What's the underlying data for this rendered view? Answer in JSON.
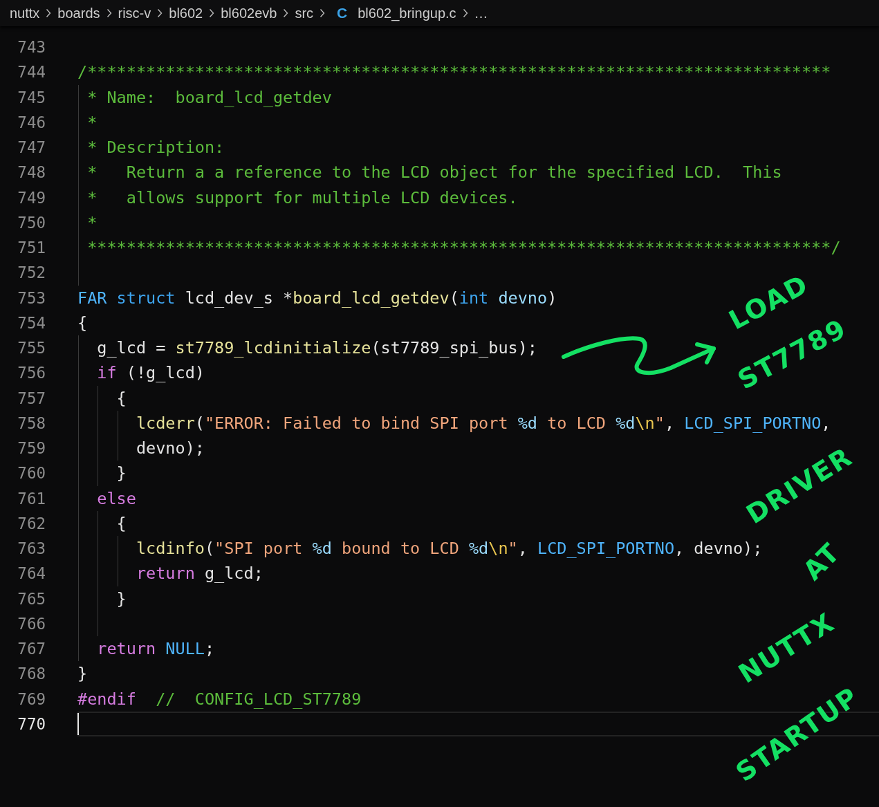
{
  "breadcrumb": {
    "items": [
      {
        "label": "nuttx",
        "kind": "folder"
      },
      {
        "label": "boards",
        "kind": "folder"
      },
      {
        "label": "risc-v",
        "kind": "folder"
      },
      {
        "label": "bl602",
        "kind": "folder"
      },
      {
        "label": "bl602evb",
        "kind": "folder"
      },
      {
        "label": "src",
        "kind": "folder"
      },
      {
        "label": "bl602_bringup.c",
        "kind": "file",
        "file_icon": "C"
      },
      {
        "label": "…",
        "kind": "more"
      }
    ]
  },
  "editor": {
    "lines": [
      {
        "number": "743",
        "current": false
      },
      {
        "number": "744",
        "current": false,
        "tokens": [
          {
            "text": "/****************************************************************************",
            "kind": "comment"
          }
        ]
      },
      {
        "number": "745",
        "current": false,
        "tokens": [
          {
            "text": " * Name:  board_lcd_getdev",
            "kind": "comment"
          }
        ]
      },
      {
        "number": "746",
        "current": false,
        "tokens": [
          {
            "text": " *",
            "kind": "comment"
          }
        ]
      },
      {
        "number": "747",
        "current": false,
        "tokens": [
          {
            "text": " * Description:",
            "kind": "comment"
          }
        ]
      },
      {
        "number": "748",
        "current": false,
        "tokens": [
          {
            "text": " *   Return a a reference to the LCD object for the specified LCD.  This",
            "kind": "comment"
          }
        ]
      },
      {
        "number": "749",
        "current": false,
        "tokens": [
          {
            "text": " *   allows support for multiple LCD devices.",
            "kind": "comment"
          }
        ]
      },
      {
        "number": "750",
        "current": false,
        "tokens": [
          {
            "text": " *",
            "kind": "comment"
          }
        ]
      },
      {
        "number": "751",
        "current": false,
        "tokens": [
          {
            "text": " ****************************************************************************/",
            "kind": "comment"
          }
        ]
      },
      {
        "number": "752",
        "current": false
      },
      {
        "number": "753",
        "current": false,
        "tokens": [
          {
            "text": "FAR ",
            "kind": "macro"
          },
          {
            "text": "struct",
            "kind": "keyword"
          },
          {
            "text": " lcd_dev_s *",
            "kind": "plain"
          },
          {
            "text": "board_lcd_getdev",
            "kind": "function"
          },
          {
            "text": "(",
            "kind": "plain"
          },
          {
            "text": "int ",
            "kind": "keyword"
          },
          {
            "text": "devno",
            "kind": "param"
          },
          {
            "text": ")",
            "kind": "plain"
          }
        ]
      },
      {
        "number": "754",
        "current": false,
        "tokens": [
          {
            "text": "{",
            "kind": "plain"
          }
        ]
      },
      {
        "number": "755",
        "current": false,
        "tokens": [
          {
            "text": "  g_lcd = ",
            "kind": "plain"
          },
          {
            "text": "st7789_lcdinitialize",
            "kind": "function"
          },
          {
            "text": "(st7789_spi_bus);",
            "kind": "plain"
          }
        ]
      },
      {
        "number": "756",
        "current": false,
        "tokens": [
          {
            "text": "  if",
            "kind": "control"
          },
          {
            "text": " (!g_lcd)",
            "kind": "plain"
          }
        ]
      },
      {
        "number": "757",
        "current": false,
        "tokens": [
          {
            "text": "    {",
            "kind": "plain"
          }
        ]
      },
      {
        "number": "758",
        "current": false,
        "tokens": [
          {
            "text": "      lcderr",
            "kind": "function"
          },
          {
            "text": "(",
            "kind": "plain"
          },
          {
            "text": "\"ERROR: Failed to bind SPI port ",
            "kind": "string"
          },
          {
            "text": "%d",
            "kind": "format"
          },
          {
            "text": " to LCD ",
            "kind": "string"
          },
          {
            "text": "%d",
            "kind": "format"
          },
          {
            "text": "\\n",
            "kind": "escape"
          },
          {
            "text": "\"",
            "kind": "string"
          },
          {
            "text": ", ",
            "kind": "plain"
          },
          {
            "text": "LCD_SPI_PORTNO",
            "kind": "macro"
          },
          {
            "text": ",",
            "kind": "plain"
          }
        ]
      },
      {
        "number": "759",
        "current": false,
        "tokens": [
          {
            "text": "      devno);",
            "kind": "plain"
          }
        ]
      },
      {
        "number": "760",
        "current": false,
        "tokens": [
          {
            "text": "    }",
            "kind": "plain"
          }
        ]
      },
      {
        "number": "761",
        "current": false,
        "tokens": [
          {
            "text": "  else",
            "kind": "control"
          }
        ]
      },
      {
        "number": "762",
        "current": false,
        "tokens": [
          {
            "text": "    {",
            "kind": "plain"
          }
        ]
      },
      {
        "number": "763",
        "current": false,
        "tokens": [
          {
            "text": "      lcdinfo",
            "kind": "function"
          },
          {
            "text": "(",
            "kind": "plain"
          },
          {
            "text": "\"SPI port ",
            "kind": "string"
          },
          {
            "text": "%d",
            "kind": "format"
          },
          {
            "text": " bound to LCD ",
            "kind": "string"
          },
          {
            "text": "%d",
            "kind": "format"
          },
          {
            "text": "\\n",
            "kind": "escape"
          },
          {
            "text": "\"",
            "kind": "string"
          },
          {
            "text": ", ",
            "kind": "plain"
          },
          {
            "text": "LCD_SPI_PORTNO",
            "kind": "macro"
          },
          {
            "text": ", devno);",
            "kind": "plain"
          }
        ]
      },
      {
        "number": "764",
        "current": false,
        "tokens": [
          {
            "text": "      return",
            "kind": "control"
          },
          {
            "text": " g_lcd;",
            "kind": "plain"
          }
        ]
      },
      {
        "number": "765",
        "current": false,
        "tokens": [
          {
            "text": "    }",
            "kind": "plain"
          }
        ]
      },
      {
        "number": "766",
        "current": false
      },
      {
        "number": "767",
        "current": false,
        "tokens": [
          {
            "text": "  return ",
            "kind": "control"
          },
          {
            "text": "NULL",
            "kind": "macro"
          },
          {
            "text": ";",
            "kind": "plain"
          }
        ]
      },
      {
        "number": "768",
        "current": false,
        "tokens": [
          {
            "text": "}",
            "kind": "plain"
          }
        ]
      },
      {
        "number": "769",
        "current": false,
        "tokens": [
          {
            "text": "#endif  ",
            "kind": "control"
          },
          {
            "text": "//  CONFIG_LCD_ST7789",
            "kind": "comment"
          }
        ]
      },
      {
        "number": "770",
        "current": true
      }
    ]
  },
  "annotation": {
    "words": [
      "LOAD",
      "ST7789",
      "DRIVER",
      "AT",
      "NUTTX",
      "STARTUP"
    ]
  }
}
